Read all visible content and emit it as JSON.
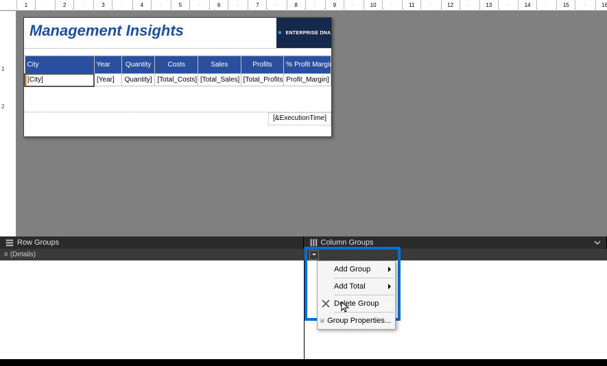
{
  "ruler": {
    "ticks": [
      "1",
      "·",
      "2",
      "·",
      "3",
      "·",
      "4",
      "·",
      "5",
      "·",
      "6",
      "·",
      "7",
      "·",
      "8",
      "·",
      "9",
      "·",
      "10",
      "·",
      "11",
      "·",
      "12",
      "·",
      "13",
      "·",
      "14",
      "·",
      "15",
      "·",
      "16",
      "·"
    ]
  },
  "report": {
    "title": "Management Insights",
    "logo_text": "ENTERPRISE DNA",
    "columns": [
      {
        "key": "city",
        "header": "City"
      },
      {
        "key": "year",
        "header": "Year"
      },
      {
        "key": "qty",
        "header": "Quantity"
      },
      {
        "key": "costs",
        "header": "Costs"
      },
      {
        "key": "sales",
        "header": "Sales"
      },
      {
        "key": "profits",
        "header": "Profits"
      },
      {
        "key": "margin",
        "header": "% Profit Margin"
      }
    ],
    "detail_row": {
      "city": "[City]",
      "year": "[Year]",
      "qty": "Quantity]",
      "costs": "[Total_Costs]",
      "sales": "[Total_Sales]",
      "profits": "[Total_Profits]",
      "margin": "Profit_Margin]"
    },
    "exec_time": "[&ExecutionTime]"
  },
  "groups": {
    "row_label": "Row Groups",
    "col_label": "Column Groups",
    "details_label": "(Details)"
  },
  "menu": {
    "add_group": "Add Group",
    "add_total": "Add Total",
    "delete_group": "Delete Group",
    "group_props": "Group Properties..."
  },
  "ruler_left": {
    "mark1": "1",
    "mark2": "2"
  }
}
